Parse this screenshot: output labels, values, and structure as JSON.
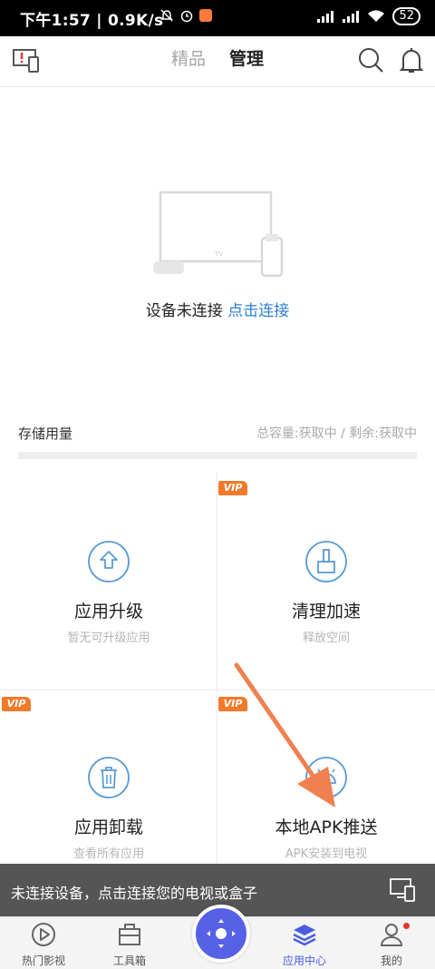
{
  "status_bar": {
    "time": "下午1:57",
    "speed": "0.9K/s",
    "battery": "52",
    "icons": [
      "mute-icon",
      "alarm-icon",
      "app-badge-icon",
      "signal-icon",
      "signal-icon",
      "wifi-icon",
      "battery-icon"
    ]
  },
  "header": {
    "tabs": [
      {
        "label": "精品",
        "active": false
      },
      {
        "label": "管理",
        "active": true
      }
    ],
    "icons": [
      "device-manage-icon",
      "search-icon",
      "bell-icon"
    ]
  },
  "connection": {
    "status": "设备未连接",
    "action": "点击连接"
  },
  "storage": {
    "label": "存储用量",
    "info": "总容量:获取中 / 剩余:获取中"
  },
  "grid": [
    {
      "title": "应用升级",
      "subtitle": "暂无可升级应用",
      "icon": "upgrade-icon",
      "vip": false
    },
    {
      "title": "清理加速",
      "subtitle": "释放空间",
      "icon": "broom-icon",
      "vip": true
    },
    {
      "title": "应用卸载",
      "subtitle": "查看所有应用",
      "icon": "trash-icon",
      "vip": true
    },
    {
      "title": "本地APK推送",
      "subtitle": "APK安装到电视",
      "icon": "android-icon",
      "vip": true
    }
  ],
  "vip_label": "VIP",
  "banner": {
    "text": "未连接设备，点击连接您的电视或盒子"
  },
  "nav": [
    {
      "label": "热门影视",
      "icon": "play-icon",
      "active": false
    },
    {
      "label": "工具箱",
      "icon": "toolbox-icon",
      "active": false
    },
    {
      "label": "应用中心",
      "icon": "layers-icon",
      "active": true
    },
    {
      "label": "我的",
      "icon": "user-icon",
      "active": false
    }
  ],
  "colors": {
    "accent": "#4c5ce0",
    "link": "#2b7fd3",
    "vip": "#f07b2b",
    "arrow": "#f08050",
    "banner_bg": "#555555"
  }
}
